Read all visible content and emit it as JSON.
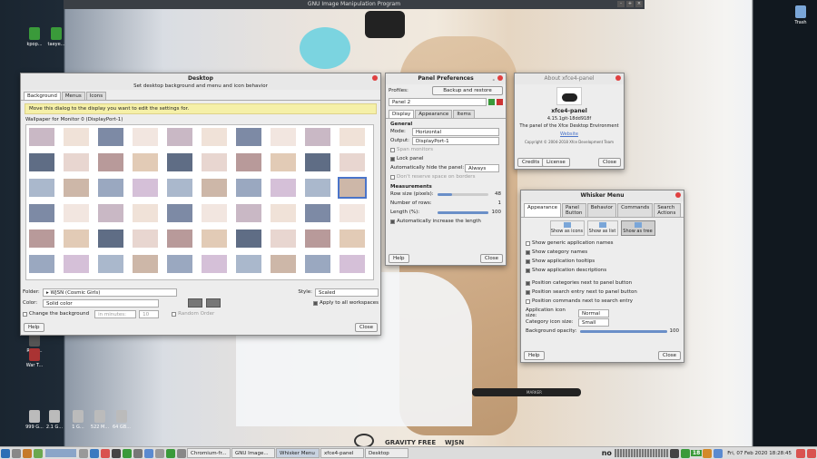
{
  "desktop": {
    "gimp_title": "GNU Image Manipulation Program",
    "icons_left": [
      {
        "label": "kpop..."
      },
      {
        "label": "taeye..."
      }
    ],
    "trash_label": "Trash",
    "left_icons_bottom": [
      {
        "label": "Robo..."
      },
      {
        "label": "War T..."
      }
    ],
    "bottom_icons": [
      "999 G...",
      "2.1 G...",
      "1 G...",
      "522 M...",
      "64 GB..."
    ],
    "wall_brand": "GRAVITY FREE",
    "wall_name": "WJSN",
    "wall_pen_text": "MARKER"
  },
  "desktop_dialog": {
    "title": "Desktop",
    "subtitle": "Set desktop background and menu and icon behavior",
    "tabs": [
      "Background",
      "Menus",
      "Icons"
    ],
    "notice": "Move this dialog to the display you want to edit the settings for.",
    "wallpaper_label": "Wallpaper for Monitor 0 (DisplayPort-1)",
    "folder_label": "Folder:",
    "folder_value": "WJSN (Cosmic Girls)",
    "style_label": "Style:",
    "style_value": "Scaled",
    "color_label": "Color:",
    "color_value": "Solid color",
    "apply_all": "Apply to all workspaces",
    "change_bg": "Change the background",
    "interval_unit": "in minutes:",
    "interval_value": "10",
    "random_order": "Random Order",
    "help": "Help",
    "close": "Close"
  },
  "panel_prefs": {
    "title": "Panel Preferences",
    "profiles_label": "Profiles:",
    "backup_btn": "Backup and restore",
    "panel_select": "Panel 2",
    "tabs": [
      "Display",
      "Appearance",
      "Items"
    ],
    "general": "General",
    "mode_label": "Mode:",
    "mode_value": "Horizontal",
    "output_label": "Output:",
    "output_value": "DisplayPort-1",
    "lock_panel": "Lock panel",
    "span_monitors": "Span monitors",
    "autohide_label": "Automatically hide the panel:",
    "autohide_value": "Always",
    "dont_reserve": "Don't reserve space on borders",
    "measurements": "Measurements",
    "row_size_label": "Row size (pixels):",
    "row_size_value": "48",
    "num_rows_label": "Number of rows:",
    "num_rows_value": "1",
    "length_label": "Length (%):",
    "length_value": "100",
    "auto_increase": "Automatically increase the length",
    "help": "Help",
    "close": "Close"
  },
  "about": {
    "title": "About xfce4-panel",
    "name": "xfce4-panel",
    "version": "4.15.1git-18dd918f",
    "desc": "The panel of the Xfce Desktop Environment",
    "website": "Website",
    "copyright": "Copyright © 2004-2018 Xfce Development Team",
    "credits": "Credits",
    "license": "License",
    "close": "Close"
  },
  "whisker": {
    "title": "Whisker Menu",
    "tabs": [
      "Appearance",
      "Panel Button",
      "Behavior",
      "Commands",
      "Search Actions"
    ],
    "view_icons": "Show as icons",
    "view_list": "Show as list",
    "view_tree": "Show as tree",
    "opts": [
      {
        "label": "Show generic application names",
        "on": false
      },
      {
        "label": "Show category names",
        "on": true
      },
      {
        "label": "Show application tooltips",
        "on": true
      },
      {
        "label": "Show application descriptions",
        "on": true
      },
      {
        "label": "Position categories next to panel button",
        "on": true
      },
      {
        "label": "Position search entry next to panel button",
        "on": true
      },
      {
        "label": "Position commands next to search entry",
        "on": false
      }
    ],
    "app_icon_label": "Application icon size:",
    "app_icon_value": "Normal",
    "cat_icon_label": "Category icon size:",
    "cat_icon_value": "Small",
    "opacity_label": "Background opacity:",
    "opacity_value": "100",
    "help": "Help",
    "close": "Close"
  },
  "taskbar": {
    "tasks": [
      "Chromium-fr...",
      "GNU Image...",
      "Whisker Menu",
      "xfce4-panel",
      "Desktop"
    ],
    "no_label": "no",
    "badge": "18",
    "clock": "Fri, 07 Feb 2020 18:28:45"
  },
  "colors": {
    "accent": "#4a74c9",
    "close_red": "#e04040",
    "notice_yellow": "#f5f0a8"
  }
}
